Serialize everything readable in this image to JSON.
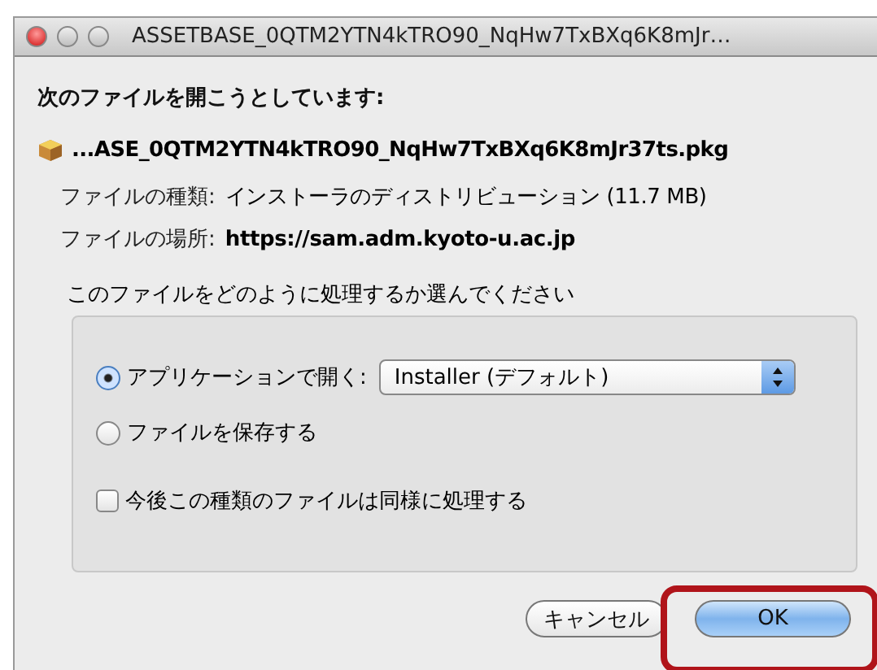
{
  "window": {
    "title": "ASSETBASE_0QTM2YTN4kTRO90_NqHw7TxBXq6K8mJr…"
  },
  "heading": "次のファイルを開こうとしています:",
  "file": {
    "name": "...ASE_0QTM2YTN4kTRO90_NqHw7TxBXq6K8mJr37ts.pkg",
    "details": [
      {
        "label": "ファイルの種類:",
        "value": "インストーラのディストリビューション (11.7 MB)",
        "bold": false
      },
      {
        "label": "ファイルの場所:",
        "value": "https://sam.adm.kyoto-u.ac.jp",
        "bold": true
      }
    ]
  },
  "group": {
    "label": "このファイルをどのように処理するか選んでください",
    "options": [
      {
        "kind": "radio",
        "label": "アプリケーションで開く:",
        "selected": true,
        "select_value": "Installer (デフォルト)"
      },
      {
        "kind": "radio",
        "label": "ファイルを保存する",
        "selected": false
      },
      {
        "kind": "checkbox",
        "label": "今後この種類のファイルは同様に処理する",
        "checked": false
      }
    ]
  },
  "buttons": [
    {
      "label": "キャンセル",
      "default": false,
      "highlighted": false
    },
    {
      "label": "OK",
      "default": true,
      "highlighted": true
    }
  ]
}
